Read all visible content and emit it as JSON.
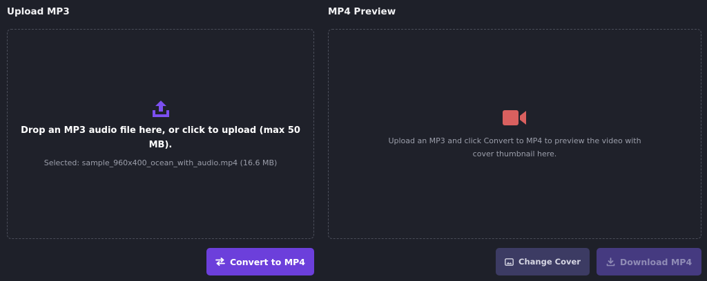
{
  "upload": {
    "title": "Upload MP3",
    "icon": "upload-icon",
    "drop_text": "Drop an MP3 audio file here, or click to upload (max 50 MB).",
    "selected_text": "Selected: sample_960x400_ocean_with_audio.mp4 (16.6 MB)",
    "convert_label": "Convert to MP4",
    "convert_icon": "swap-arrows-icon"
  },
  "preview": {
    "title": "MP4 Preview",
    "icon": "video-camera-icon",
    "placeholder_text": "Upload an MP3 and click Convert to MP4 to preview the video with cover thumbnail here.",
    "change_cover_label": "Change Cover",
    "change_cover_icon": "image-icon",
    "download_label": "Download MP4",
    "download_icon": "download-icon"
  },
  "colors": {
    "background": "#1e2029",
    "accent": "#6c3fdb",
    "video_icon": "#d9605f",
    "muted_text": "#9b9eaa"
  }
}
